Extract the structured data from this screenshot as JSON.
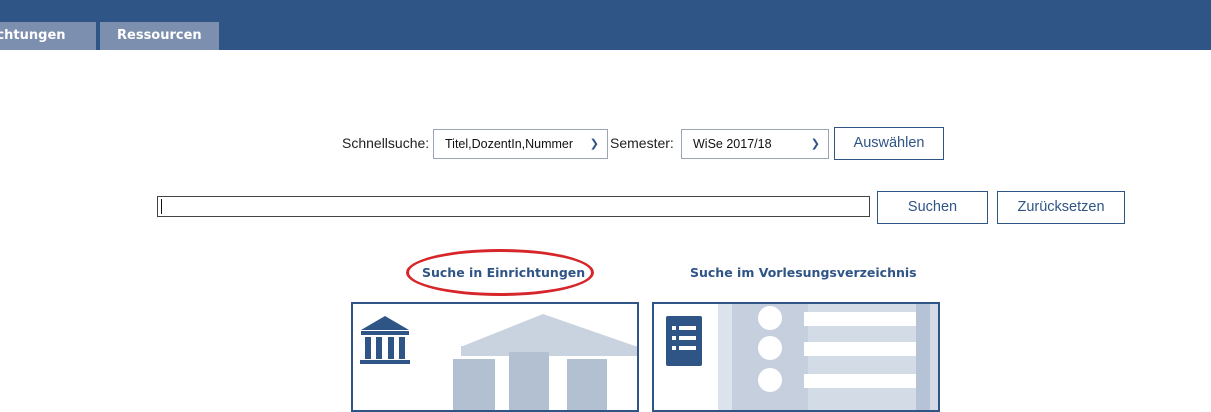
{
  "nav": {
    "tabs": [
      {
        "label": "ichtungen"
      },
      {
        "label": "Ressourcen"
      }
    ]
  },
  "quicksearch": {
    "label": "Schnellsuche:",
    "selected": "Titel,DozentIn,Nummer"
  },
  "semester": {
    "label": "Semester:",
    "selected": "WiSe 2017/18"
  },
  "buttons": {
    "select": "Auswählen",
    "search": "Suchen",
    "reset": "Zurücksetzen"
  },
  "search": {
    "value": ""
  },
  "sections": {
    "einrichtungen": "Suche in Einrichtungen",
    "vorlesungen": "Suche im Vorlesungsverzeichnis"
  },
  "colors": {
    "brand": "#2f5486",
    "tab": "#7d8fae",
    "highlight": "#d6262a"
  },
  "icons": {
    "card1": "institution-icon",
    "card2": "list-icon"
  }
}
